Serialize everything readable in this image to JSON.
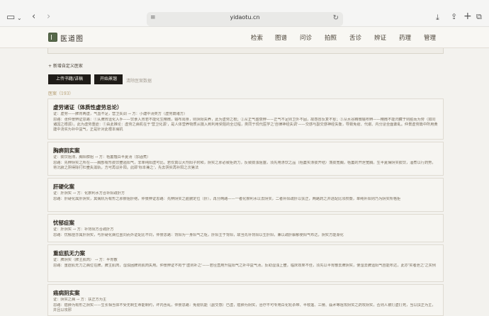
{
  "browser": {
    "url": "yidaotu.cn"
  },
  "site": {
    "logo_text": "医道图",
    "nav": [
      "检索",
      "图谱",
      "问诊",
      "拍照",
      "舌诊",
      "辨证",
      "药理",
      "管理"
    ]
  },
  "page": {
    "add_link": "+ 新增自定义医家",
    "buttons": [
      "上传书籍/讲稿",
      "开始蒸馏"
    ],
    "muted_link": "清除医案数据",
    "count": "医案（193）",
    "cards": [
      {
        "title": "虚劳诸证（体质性虚劳总论）",
        "lines": [
          "证：虚劳——脾胃两虚，气血不足，营卫失调 → 方：小建中汤类方（虚劳篇诸方）",
          "思路：张仲景辨证思路：①从脾胃运化入手——饮食入胃若不能化生精微，输布周身，则阴阳失养，此为虚劳之根；②从正气盛衰辨——正气不足则卫外不固，故感冒反复不愈；③从水谷精微输布辨——精微不能归藏于则脏而为劳（如同诸因之根源）。此为虚劳重症：①由此推论：虚劳之病机在于'营卫化源'，是人体营养物质从摄入到利用受阻的全过程，类同于现代医学之'自律神经失调'——交感与副交感神经失衡，导致免疫、代谢、内分泌全面紊乱。仲景虚劳篇中所用黄建中汤实为补中益气，正是针对此根本病机"
        ]
      },
      {
        "title": "胸痹阴实案",
        "lines": [
          "证：痰饮阻滞，胸阳痹阻 → 方：栝蒌薤白半夏汤（加酒煮）",
          "思路：先辨阴实之所在——胸部有形痰饮壅遏阳气，非单纯阳虚可比。若仅真以大剂阳子附和，阴实之邪必致拒药力，反致痰浊阻塞，须先用涤饮之品（栝蒌实涤痰开结）荡痰宽胸，栝蒌的开泄宽胸，生半夏燥阴实痰饮，酒煮以行药势，将沉寂之阴得除打杠壅失滋轨，方可再议补阳。此即'标本兼之'，先去阴实再补阳之次第法"
        ]
      },
      {
        "title": "肝硬化案",
        "lines": [
          "证：肝阴实 → 方：化瘀利水方合补阳疏肝方",
          "思路：肝硬化属肝阴实，其病机为有形之邪瘀阻肝络，仲景辨证思路：先辨阴实之脏腑定位（肝），再分两路——一者化瘀利水以去阴实，二者补阳疏肝以扶正，两路药之并进配比须权衡，单纯补阳则乃为阴实所格拒"
        ]
      },
      {
        "title": "忧郁症案",
        "lines": [
          "证：肝阴实 → 方：补背阳方合疏肝方",
          "思路：忧郁症亦属肝阴实，与肝硬化病位虽同而外证配比不同，仲景思路：背阳为一身阳气之枢，肝阳主于背阳，故当先补背阳以生肝阳，兼以疏肝解郁使阳气布达，阴实方能渐化"
        ]
      },
      {
        "title": "重症肌无力案",
        "lines": [
          "证：脾阴实（脾主肌肉） → 方：半胃散",
          "思路：重症肌无力之病位在脾，脾主肌肉，湿浊困脾则肌肉失用。仲景辨证不拘于'虚则补之'——若径直用升提阳气之补中益气汤，反助湿浊上壅，临床效果不佳，须先以半胃散去脾阴实，使湿去脾运阳气自能布达，此亦'实者泄之'之实例"
        ]
      },
      {
        "title": "癌病阴实案",
        "lines": [
          "证：阴实之病 → 方：扶正方为主",
          "思路：癌肿为有形之阴实——生长相当体不受无制生命能制约，坏内含乱，仲景思路：免疫机能（副交感）已虚，癌肿为阴实，治疗不可专用白化轮杀带、半枝莲、三棱、莪术等祖攻阴实之药攻阴实，否则人被打虚打死，当以扶正为主，并且以攻邪"
        ]
      }
    ]
  }
}
